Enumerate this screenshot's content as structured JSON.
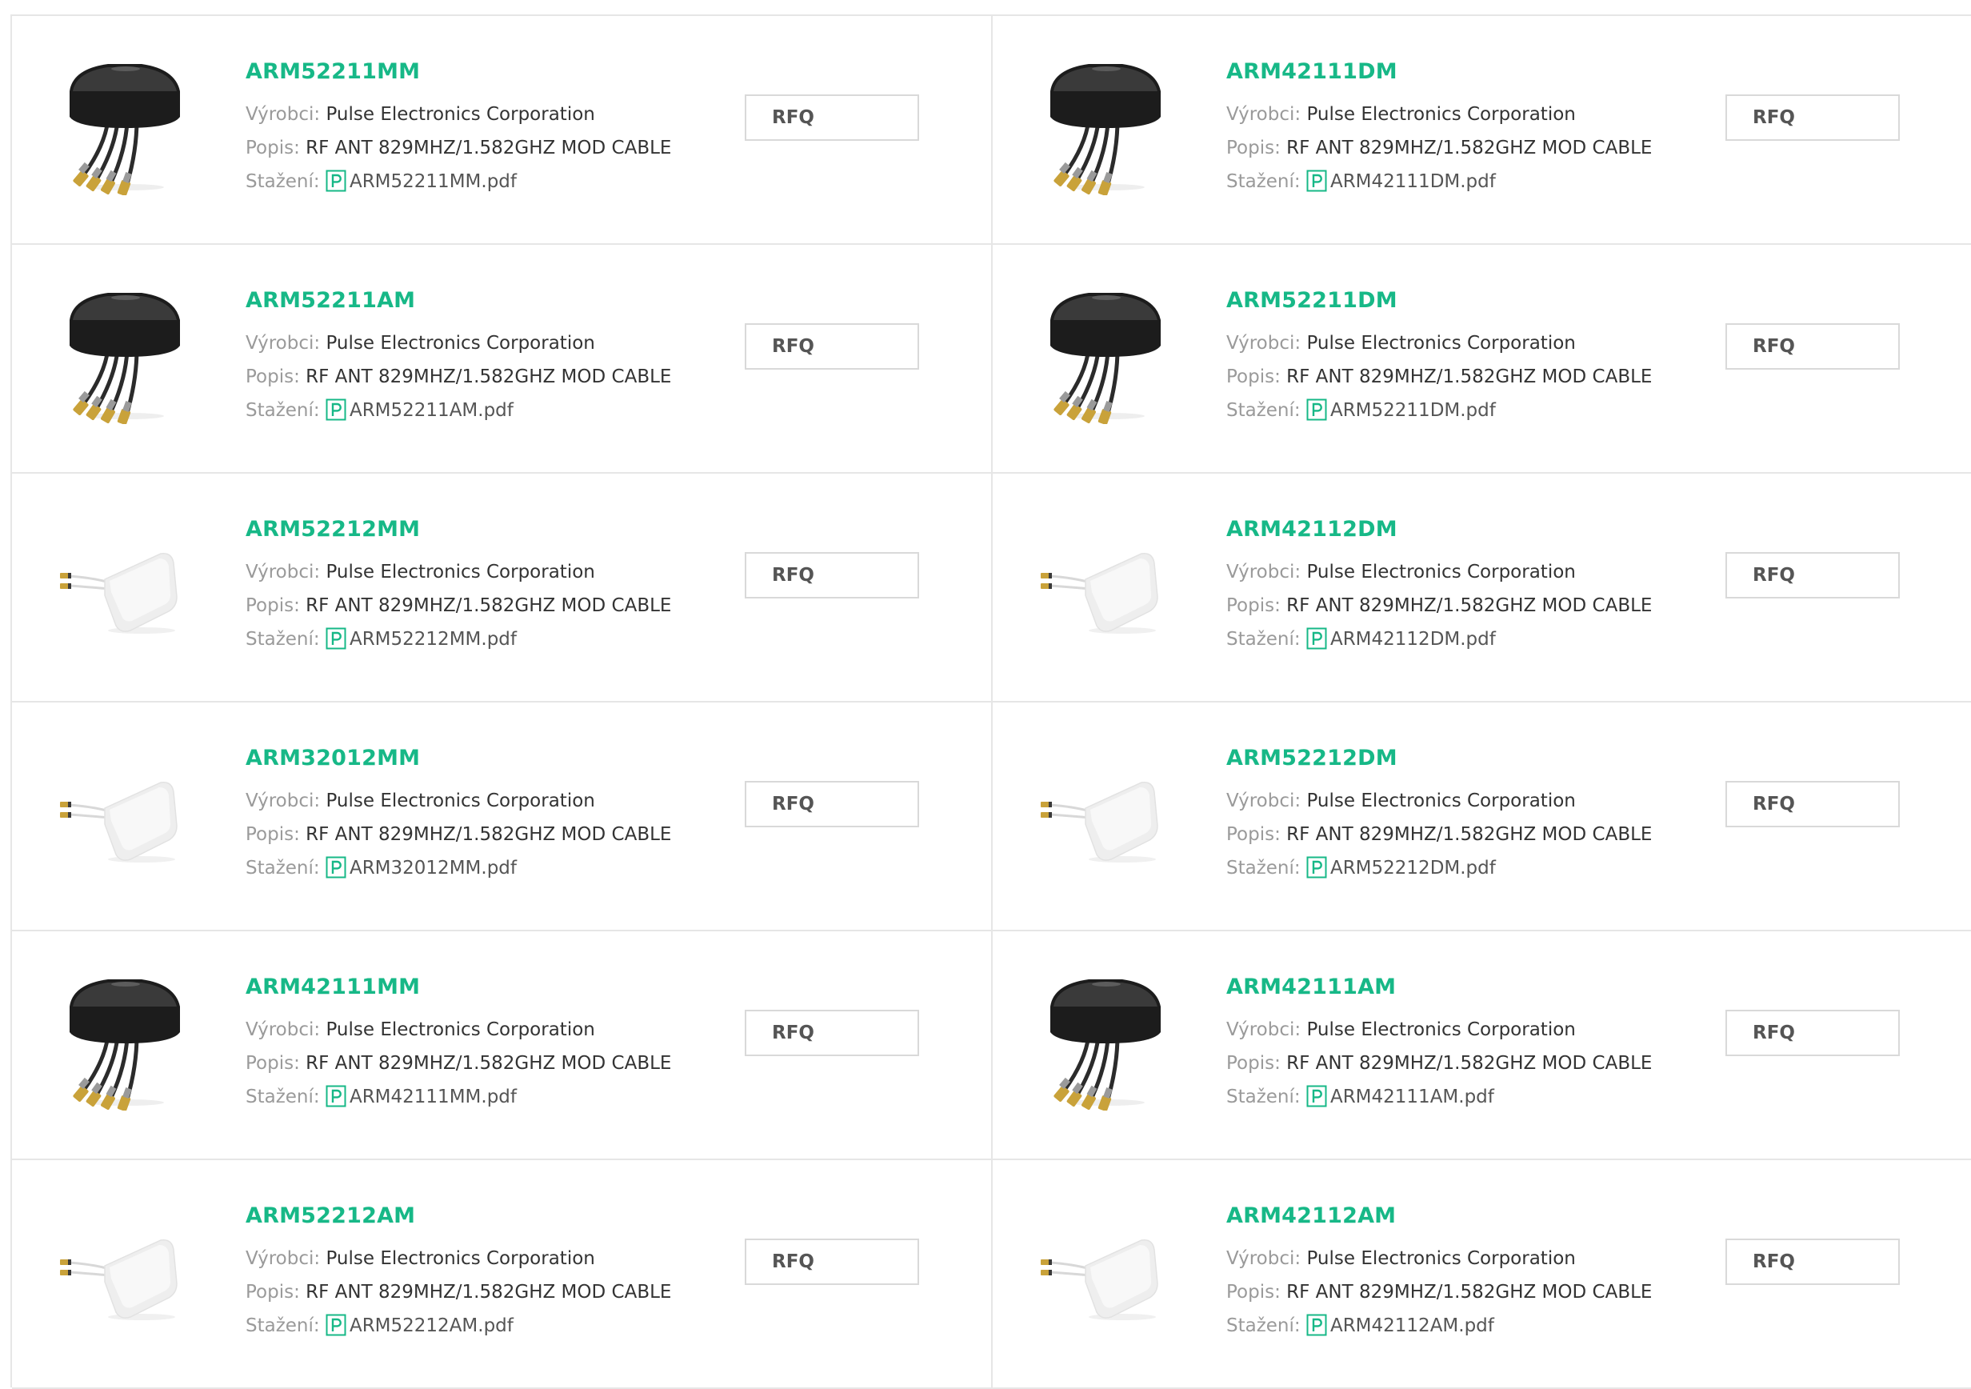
{
  "labels": {
    "manufacturer": "Výrobci:",
    "description": "Popis:",
    "download": "Stažení:",
    "rfq": "RFQ"
  },
  "accent_color": "#17b887",
  "products": [
    {
      "part": "ARM52211MM",
      "manufacturer": "Pulse Electronics Corporation",
      "description": "RF ANT 829MHZ/1.582GHZ MOD CABLE",
      "datasheet": "ARM52211MM.pdf",
      "image": "black-antenna"
    },
    {
      "part": "ARM42111DM",
      "manufacturer": "Pulse Electronics Corporation",
      "description": "RF ANT 829MHZ/1.582GHZ MOD CABLE",
      "datasheet": "ARM42111DM.pdf",
      "image": "black-antenna"
    },
    {
      "part": "ARM52211AM",
      "manufacturer": "Pulse Electronics Corporation",
      "description": "RF ANT 829MHZ/1.582GHZ MOD CABLE",
      "datasheet": "ARM52211AM.pdf",
      "image": "black-antenna"
    },
    {
      "part": "ARM52211DM",
      "manufacturer": "Pulse Electronics Corporation",
      "description": "RF ANT 829MHZ/1.582GHZ MOD CABLE",
      "datasheet": "ARM52211DM.pdf",
      "image": "black-antenna"
    },
    {
      "part": "ARM52212MM",
      "manufacturer": "Pulse Electronics Corporation",
      "description": "RF ANT 829MHZ/1.582GHZ MOD CABLE",
      "datasheet": "ARM52212MM.pdf",
      "image": "white-antenna"
    },
    {
      "part": "ARM42112DM",
      "manufacturer": "Pulse Electronics Corporation",
      "description": "RF ANT 829MHZ/1.582GHZ MOD CABLE",
      "datasheet": "ARM42112DM.pdf",
      "image": "white-antenna"
    },
    {
      "part": "ARM32012MM",
      "manufacturer": "Pulse Electronics Corporation",
      "description": "RF ANT 829MHZ/1.582GHZ MOD CABLE",
      "datasheet": "ARM32012MM.pdf",
      "image": "white-antenna"
    },
    {
      "part": "ARM52212DM",
      "manufacturer": "Pulse Electronics Corporation",
      "description": "RF ANT 829MHZ/1.582GHZ MOD CABLE",
      "datasheet": "ARM52212DM.pdf",
      "image": "white-antenna"
    },
    {
      "part": "ARM42111MM",
      "manufacturer": "Pulse Electronics Corporation",
      "description": "RF ANT 829MHZ/1.582GHZ MOD CABLE",
      "datasheet": "ARM42111MM.pdf",
      "image": "black-antenna"
    },
    {
      "part": "ARM42111AM",
      "manufacturer": "Pulse Electronics Corporation",
      "description": "RF ANT 829MHZ/1.582GHZ MOD CABLE",
      "datasheet": "ARM42111AM.pdf",
      "image": "black-antenna"
    },
    {
      "part": "ARM52212AM",
      "manufacturer": "Pulse Electronics Corporation",
      "description": "RF ANT 829MHZ/1.582GHZ MOD CABLE",
      "datasheet": "ARM52212AM.pdf",
      "image": "white-antenna"
    },
    {
      "part": "ARM42112AM",
      "manufacturer": "Pulse Electronics Corporation",
      "description": "RF ANT 829MHZ/1.582GHZ MOD CABLE",
      "datasheet": "ARM42112AM.pdf",
      "image": "white-antenna"
    }
  ]
}
